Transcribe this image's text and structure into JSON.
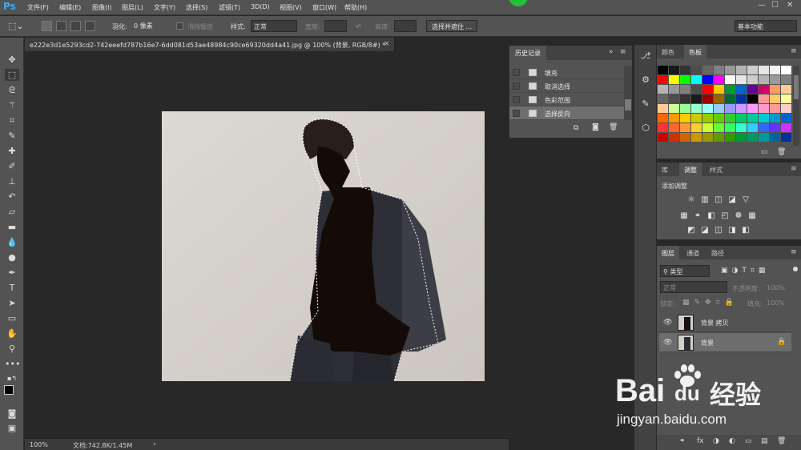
{
  "app": {
    "logo": "Ps"
  },
  "menus": [
    "文件(F)",
    "编辑(E)",
    "图像(I)",
    "图层(L)",
    "文字(Y)",
    "选择(S)",
    "滤镜(T)",
    "3D(D)",
    "视图(V)",
    "窗口(W)",
    "帮助(H)"
  ],
  "window_controls": {
    "minimize": "—",
    "maximize": "☐",
    "close": "✕"
  },
  "options": {
    "feather_label": "羽化:",
    "feather_value": "0 像素",
    "antialias_label": "消除锯齿",
    "style_label": "样式:",
    "style_value": "正常",
    "width_label": "宽度:",
    "height_label": "高度:",
    "select_mask_button": "选择并遮住 ...",
    "workspace_value": "基本功能"
  },
  "document": {
    "tab_title": "e222e3d1e5293cd2-742eeefd787b16e7-6dd081d53ae48984c90ce69320dd4a41.jpg @ 100% (背景, RGB/8#) *",
    "close": "×"
  },
  "status": {
    "zoom": "100%",
    "doc_info": "文档:742.8K/1.45M",
    "arrow": "›"
  },
  "history": {
    "title": "历史记录",
    "items": [
      {
        "label": "填充",
        "selected": false
      },
      {
        "label": "取消选择",
        "selected": false
      },
      {
        "label": "色彩范围",
        "selected": false
      },
      {
        "label": "选择反向",
        "selected": true
      }
    ]
  },
  "swatch_panel": {
    "tabs": [
      "颜色",
      "色板"
    ],
    "active_tab": "色板",
    "row_gray": [
      "#000000",
      "#1a1a1a",
      "#333333",
      "#4d4d4d",
      "#666666",
      "#808080",
      "#999999",
      "#b3b3b3",
      "#cccccc",
      "#e6e6e6",
      "#f2f2f2",
      "#ffffff"
    ],
    "row_primary": [
      "#ff0000",
      "#ffff00",
      "#00ff00",
      "#00ffff",
      "#0000ff",
      "#ff00ff",
      "#ffffff",
      "#e6e6e6",
      "#cccccc",
      "#b3b3b3",
      "#999999",
      "#808080"
    ],
    "row_dark": [
      "#b3b3b3",
      "#999999",
      "#808080",
      "#4d4d4d",
      "#ff0000",
      "#ffcc00",
      "#009933",
      "#0066cc",
      "#660099",
      "#cc0066",
      "#ff9966",
      "#ffcc99"
    ],
    "row_mid": [
      "#666666",
      "#4d4d4d",
      "#333333",
      "#1a1a1a",
      "#990000",
      "#996600",
      "#006633",
      "#003399",
      "#000000",
      "#ff9999",
      "#ffcc66",
      "#ffff99"
    ],
    "row_pastel": [
      "#ffcc99",
      "#ccff99",
      "#99ff99",
      "#99ffcc",
      "#99ffff",
      "#99ccff",
      "#9999ff",
      "#cc99ff",
      "#ff99ff",
      "#ff99cc",
      "#ff9999",
      "#ffcccc"
    ],
    "row_warm": [
      "#ff6600",
      "#ff9900",
      "#ffcc00",
      "#cccc00",
      "#99cc00",
      "#66cc00",
      "#33cc33",
      "#00cc66",
      "#00cc99",
      "#00cccc",
      "#0099cc",
      "#0066cc"
    ],
    "row_vivid": [
      "#ff3333",
      "#ff6633",
      "#ff9933",
      "#ffcc33",
      "#ccff33",
      "#66ff33",
      "#33ff66",
      "#33ffcc",
      "#33ccff",
      "#3366ff",
      "#6633ff",
      "#cc33ff"
    ],
    "row_deep": [
      "#cc0000",
      "#cc3300",
      "#cc6600",
      "#cc9900",
      "#999900",
      "#669900",
      "#339900",
      "#009933",
      "#009966",
      "#009999",
      "#006699",
      "#003399"
    ]
  },
  "adjustments": {
    "tabs": [
      "库",
      "调整",
      "样式"
    ],
    "active_tab": "调整",
    "title": "添加调整",
    "row1": [
      "☼",
      "▥",
      "◫",
      "◪",
      "▽"
    ],
    "row2": [
      "▦",
      "⚭",
      "◧",
      "◰",
      "❁",
      "▦"
    ],
    "row3": [
      "◩",
      "◪",
      "◫",
      "◨",
      "◧"
    ]
  },
  "layers": {
    "tabs": [
      "图层",
      "通道",
      "路径"
    ],
    "active_tab": "图层",
    "filter_label": "类型",
    "blend_mode": "正常",
    "opacity_label": "不透明度:",
    "opacity_value": "100%",
    "lock_label": "锁定:",
    "fill_label": "填充:",
    "fill_value": "100%",
    "items": [
      {
        "name": "背景 拷贝",
        "selected": false,
        "locked": false
      },
      {
        "name": "背景",
        "selected": true,
        "locked": true
      }
    ],
    "bottom_icons": [
      "⚭",
      "fx",
      "◑",
      "◐",
      "▭",
      "▤",
      "🗑"
    ]
  },
  "watermark": {
    "text_top": "Bai",
    "text_du": "du",
    "text_cn": "经验",
    "url": "jingyan.baidu.com"
  }
}
